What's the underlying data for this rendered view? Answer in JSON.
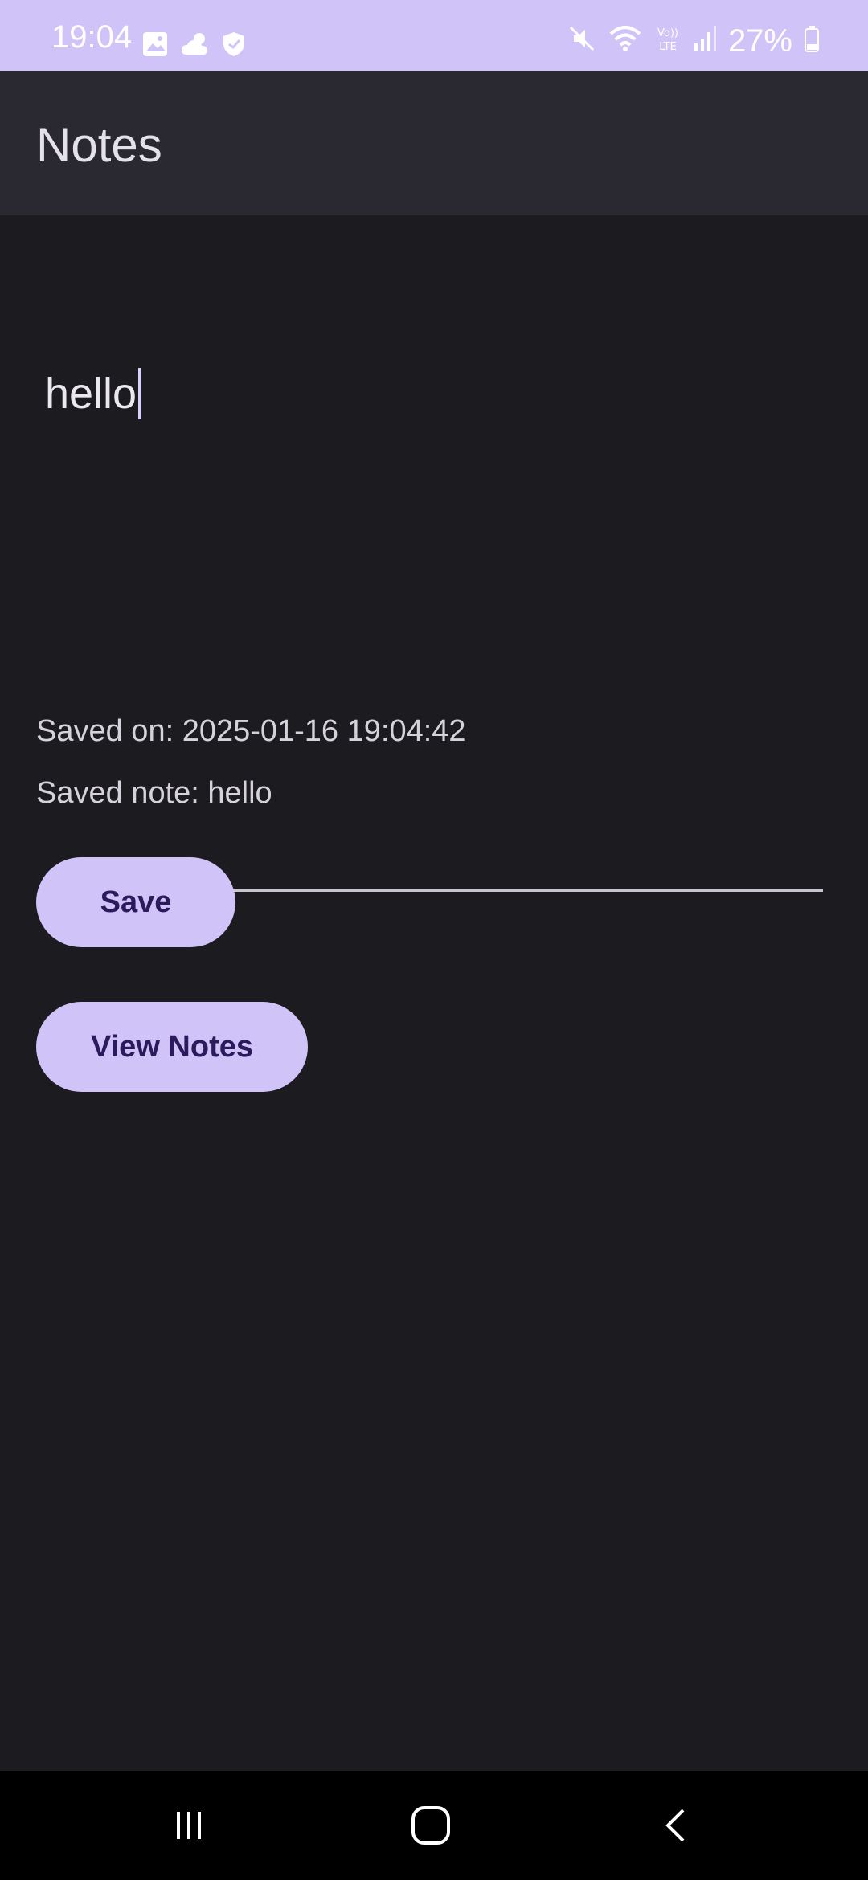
{
  "status_bar": {
    "time": "19:04",
    "battery": "27%",
    "icons": [
      "gallery-icon",
      "weather-icon",
      "shield-icon",
      "mute-icon",
      "wifi-icon",
      "volte-icon",
      "signal-icon",
      "battery-icon"
    ]
  },
  "app_bar": {
    "title": "Notes"
  },
  "editor": {
    "value": "hello"
  },
  "info": {
    "saved_on": "Saved on: 2025-01-16 19:04:42",
    "saved_note": "Saved note: hello"
  },
  "buttons": {
    "save": "Save",
    "view_notes": "View Notes"
  },
  "nav_bar": {
    "items": [
      "recent-apps-icon",
      "home-icon",
      "back-icon"
    ]
  },
  "colors": {
    "accent": "#d0c3f8",
    "background": "#1c1b20",
    "app_bar": "#2a2931",
    "button_text": "#2b1a5c"
  }
}
